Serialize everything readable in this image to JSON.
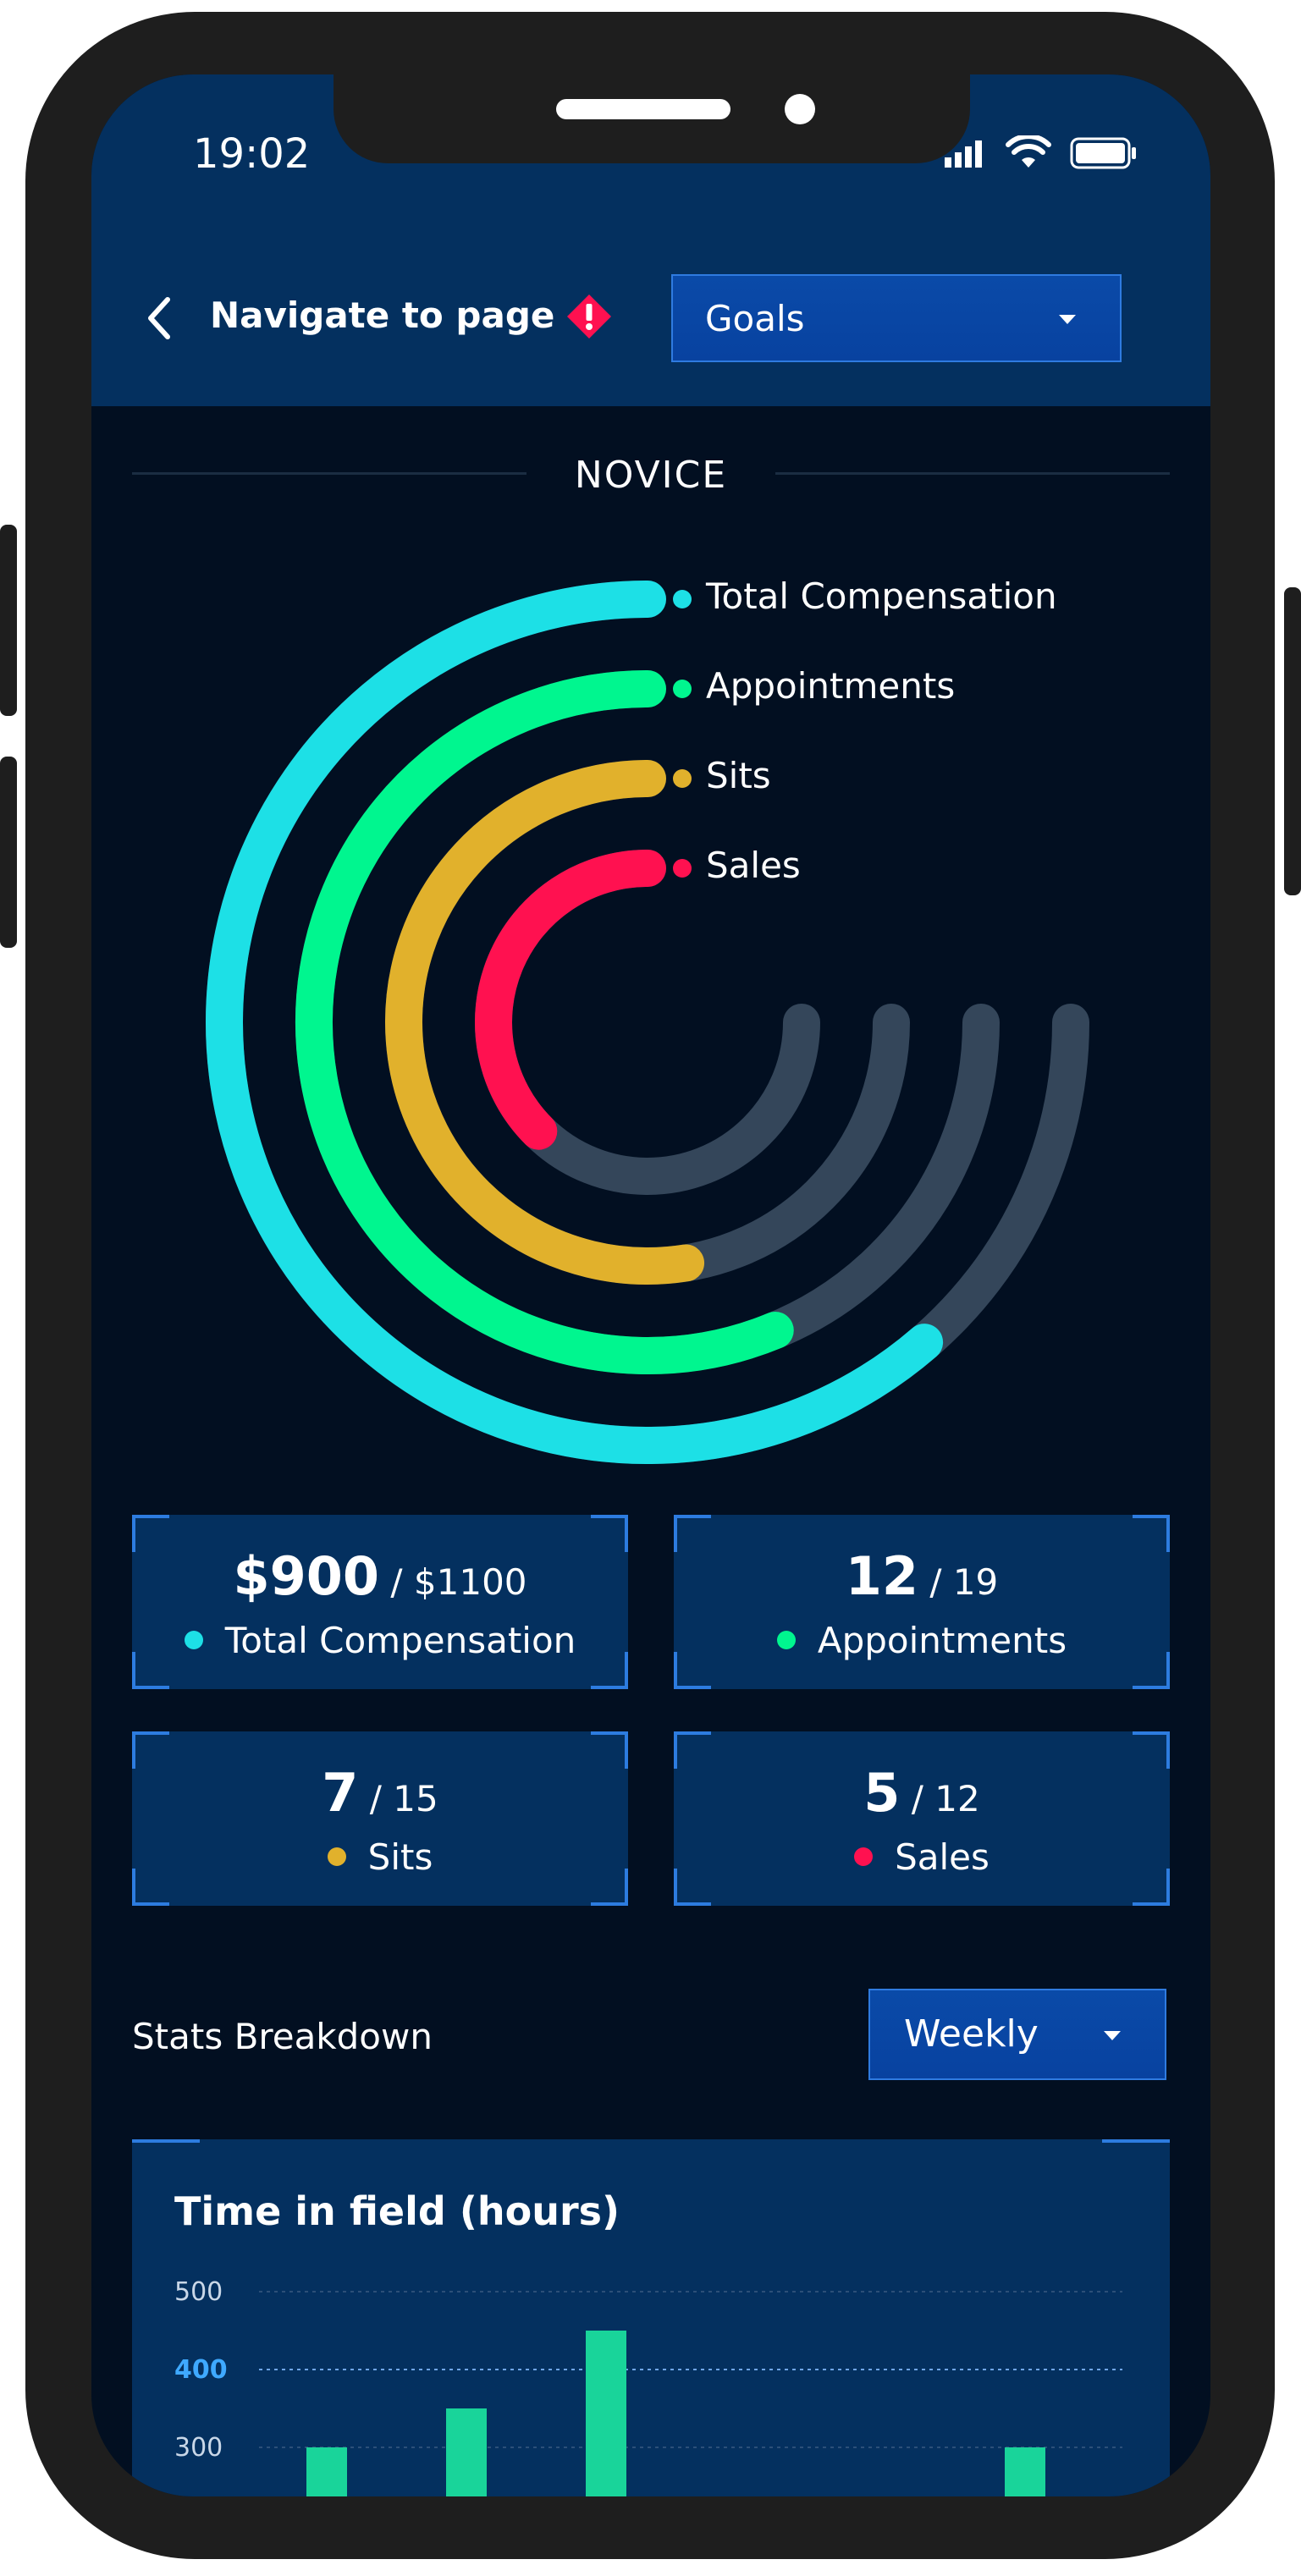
{
  "status_bar": {
    "time": "19:02"
  },
  "header": {
    "title": "Navigate to page",
    "page_select": "Goals"
  },
  "level": "NOVICE",
  "rings": [
    {
      "name": "Total Compensation",
      "color": "#1de0e6",
      "progress": 0.818
    },
    {
      "name": "Appointments",
      "color": "#00f68f",
      "progress": 0.75
    },
    {
      "name": "Sits",
      "color": "#e1b12c",
      "progress": 0.7
    },
    {
      "name": "Sales",
      "color": "#ff1150",
      "progress": 0.5
    }
  ],
  "ring_track_color": "#34465a",
  "cards": [
    {
      "value": "$900",
      "goal": "/ $1100",
      "label": "Total Compensation",
      "color": "#1de0e6"
    },
    {
      "value": "12",
      "goal": "/ 19",
      "label": "Appointments",
      "color": "#00f68f"
    },
    {
      "value": "7",
      "goal": "/ 15",
      "label": "Sits",
      "color": "#e1b12c"
    },
    {
      "value": "5",
      "goal": "/ 12",
      "label": "Sales",
      "color": "#ff1150"
    }
  ],
  "stats": {
    "title": "Stats Breakdown",
    "period_select": "Weekly"
  },
  "chart": {
    "title": "Time in field (hours)"
  },
  "chart_data": {
    "type": "bar",
    "title": "Time in field (hours)",
    "ylabel": "",
    "xlabel": "",
    "y_ticks": [
      "500",
      "400",
      "300"
    ],
    "highlight_tick": "400",
    "values": [
      300,
      350,
      450,
      null,
      null,
      300
    ],
    "bar_color": "#19d49a"
  }
}
